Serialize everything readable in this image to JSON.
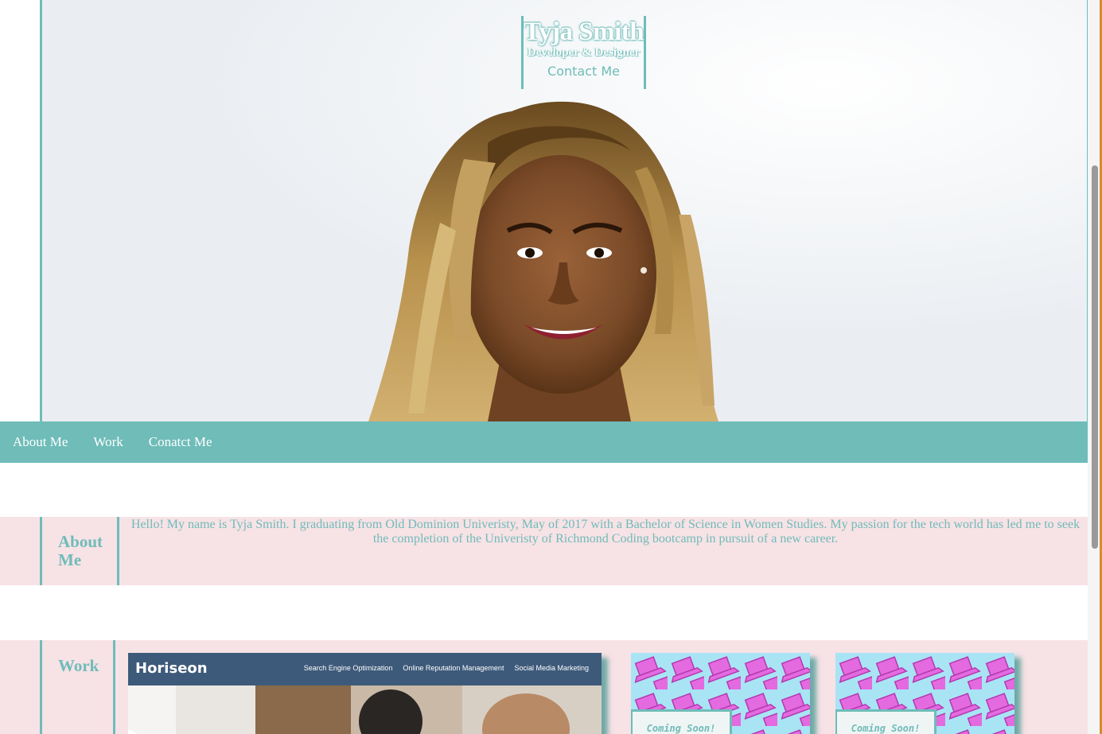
{
  "header": {
    "name": "Tyja Smith",
    "subtitle": "Developer & Designer",
    "contact_link": "Contact Me"
  },
  "nav": {
    "items": [
      {
        "label": "About Me"
      },
      {
        "label": "Work"
      },
      {
        "label": "Conatct Me"
      }
    ]
  },
  "about": {
    "heading": "About Me",
    "text": "Hello! My name is Tyja Smith. I graduating from Old Dominion Univeristy, May of 2017 with a Bachelor of Science in Women Studies. My passion for the tech world has led me to seek the completion of the Univeristy of Richmond Coding bootcamp in pursuit of a new career."
  },
  "work": {
    "heading": "Work",
    "featured": {
      "logo": "Horiseon",
      "links": [
        "Search Engine Optimization",
        "Online Reputation Management",
        "Social Media Marketing"
      ]
    },
    "placeholders": [
      {
        "label": "Coming Soon!"
      },
      {
        "label": "Coming Soon!"
      }
    ]
  },
  "colors": {
    "accent": "#6fbcb8",
    "section_bg": "#f7e2e6",
    "hero_bg": "#eef1f4",
    "laptop_pink": "#e46ae0",
    "card_bg": "#a9e4f5"
  },
  "icons": {
    "laptop_pattern": "laptop-icon"
  }
}
